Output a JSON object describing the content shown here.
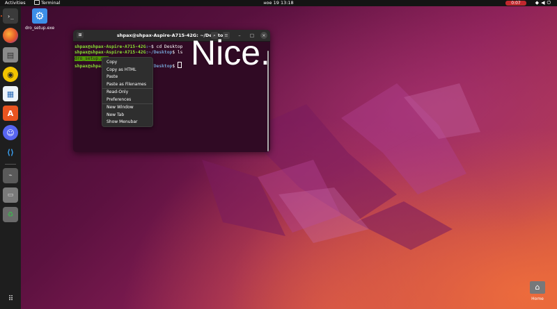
{
  "topbar": {
    "activities": "Activities",
    "app_name": "Terminal",
    "clock": "ное 19  13:18",
    "recording": "0:07",
    "tray_icons": [
      "network-icon",
      "volume-icon",
      "power-icon"
    ]
  },
  "desktop": {
    "icons": [
      {
        "label": "dro_setup.exe",
        "icon": "gear-icon"
      },
      {
        "label": "Home",
        "icon": "home-folder-icon"
      }
    ],
    "overlay_text": "Nice."
  },
  "dock": {
    "items": [
      {
        "name": "terminal",
        "glyph": "›_",
        "active": true
      },
      {
        "name": "firefox",
        "glyph": "●"
      },
      {
        "name": "files",
        "glyph": "▤"
      },
      {
        "name": "rhythmbox",
        "glyph": "◉"
      },
      {
        "name": "libreoffice-writer",
        "glyph": "▦"
      },
      {
        "name": "app-center",
        "glyph": "A"
      },
      {
        "name": "discord",
        "glyph": "☺"
      },
      {
        "name": "vscode",
        "glyph": "⟨⟩"
      },
      {
        "name": "usb-drive",
        "glyph": "⌁"
      },
      {
        "name": "disk-drive",
        "glyph": "▭"
      },
      {
        "name": "trash",
        "glyph": "♻"
      },
      {
        "name": "show-apps",
        "glyph": "⋮⋮⋮"
      }
    ]
  },
  "terminal": {
    "title": "shpax@shpax-Aspire-A715-42G: ~/Desktop",
    "lines": [
      {
        "user": "shpax@shpax-Aspire-A715-42G",
        "path": ":~",
        "cmd": "$ cd Desktop"
      },
      {
        "user": "shpax@shpax-Aspire-A715-42G",
        "path": ":~/Desktop",
        "cmd": "$ ls"
      },
      {
        "file": "dro_setup.exe"
      },
      {
        "user": "shpax@shpax-Aspire-A715-42G",
        "path": ":~/Desktop",
        "cmd": "$ "
      }
    ]
  },
  "context_menu": {
    "groups": [
      [
        "Copy",
        "Copy as HTML",
        "Paste",
        "Paste as Filenames"
      ],
      [
        "Read-Only",
        "Preferences"
      ],
      [
        "New Window",
        "New Tab",
        "Show Menubar"
      ]
    ]
  }
}
